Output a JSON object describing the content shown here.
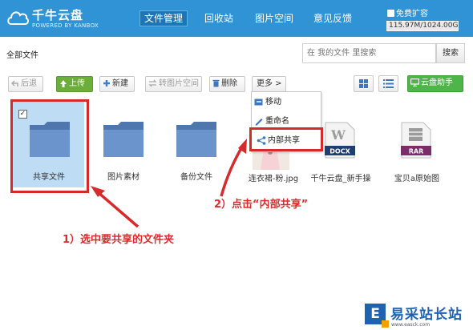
{
  "header": {
    "logo_name": "千牛云盘",
    "logo_sub": "POWERED BY KANBOX",
    "nav": [
      {
        "label": "文件管理",
        "active": true
      },
      {
        "label": "回收站",
        "active": false
      },
      {
        "label": "图片空间",
        "active": false
      },
      {
        "label": "意见反馈",
        "active": false
      }
    ],
    "expand_label": "免费扩容",
    "quota": "115.97M/1024.00G"
  },
  "breadcrumb": "全部文件",
  "search": {
    "placeholder": "在 我的文件 里搜索",
    "button": "搜索"
  },
  "toolbar": {
    "back": "后退",
    "upload": "上传",
    "new": "新建",
    "to_image_space": "转图片空间",
    "delete": "删除",
    "more": "更多 >",
    "assistant": "云盘助手"
  },
  "menu": {
    "items": [
      "移动",
      "重命名",
      "内部共享"
    ]
  },
  "files": [
    {
      "name": "共享文件",
      "type": "folder",
      "selected": true
    },
    {
      "name": "图片素材",
      "type": "folder"
    },
    {
      "name": "备份文件",
      "type": "folder"
    },
    {
      "name": "连衣裙-粉.jpg",
      "type": "image"
    },
    {
      "name": "千牛云盘_新手操",
      "type": "docx",
      "badge": "DOCX"
    },
    {
      "name": "宝贝a原始图",
      "type": "rar",
      "badge": "RAR"
    }
  ],
  "annotations": {
    "step1": "1）选中要共享的文件夹",
    "step2": "2）点击“内部共享”"
  },
  "watermark": {
    "title": "易采站长站",
    "url": "www.easck.com",
    "badge": "E"
  },
  "colors": {
    "header": "#2f93d6",
    "highlight": "#d42a2a",
    "select": "#bedcf3",
    "folder": "#5a85bf"
  }
}
